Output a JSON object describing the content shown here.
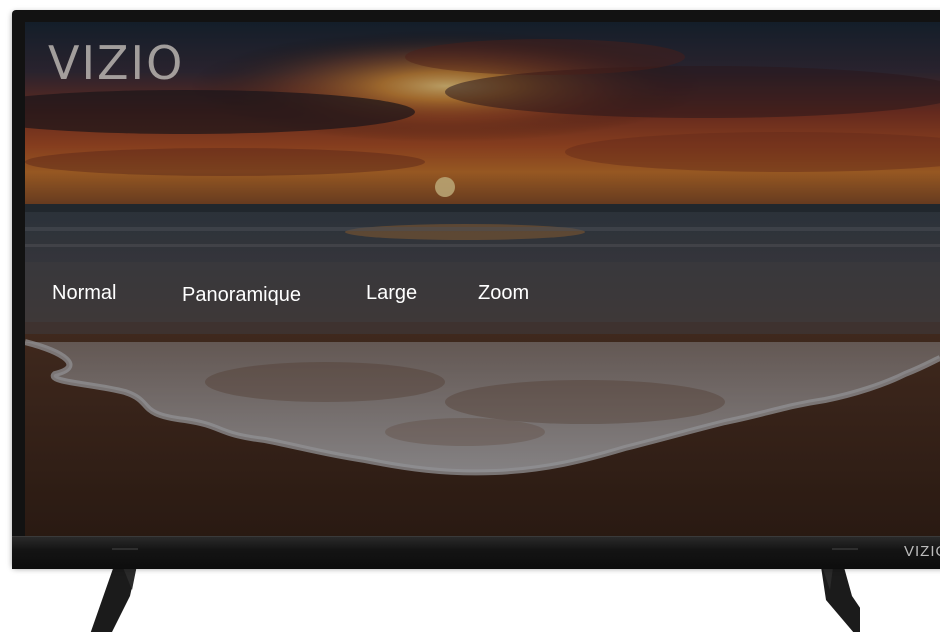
{
  "screen": {
    "logo": "VIZIO"
  },
  "aspect_menu": {
    "options": [
      {
        "label": "Normal"
      },
      {
        "label": "Panoramique"
      },
      {
        "label": "Large"
      },
      {
        "label": "Zoom"
      }
    ]
  },
  "bezel": {
    "brand": "VIZIO"
  },
  "colors": {
    "frame": "#121212",
    "menu_text": "#ffffff",
    "logo": "#b9b4b0"
  }
}
